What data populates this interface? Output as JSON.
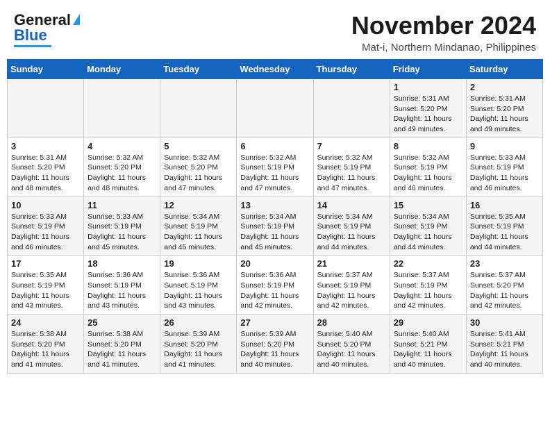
{
  "header": {
    "logo_line1": "General",
    "logo_line2": "Blue",
    "month": "November 2024",
    "location": "Mat-i, Northern Mindanao, Philippines"
  },
  "weekdays": [
    "Sunday",
    "Monday",
    "Tuesday",
    "Wednesday",
    "Thursday",
    "Friday",
    "Saturday"
  ],
  "weeks": [
    [
      {
        "day": "",
        "info": ""
      },
      {
        "day": "",
        "info": ""
      },
      {
        "day": "",
        "info": ""
      },
      {
        "day": "",
        "info": ""
      },
      {
        "day": "",
        "info": ""
      },
      {
        "day": "1",
        "info": "Sunrise: 5:31 AM\nSunset: 5:20 PM\nDaylight: 11 hours\nand 49 minutes."
      },
      {
        "day": "2",
        "info": "Sunrise: 5:31 AM\nSunset: 5:20 PM\nDaylight: 11 hours\nand 49 minutes."
      }
    ],
    [
      {
        "day": "3",
        "info": "Sunrise: 5:31 AM\nSunset: 5:20 PM\nDaylight: 11 hours\nand 48 minutes."
      },
      {
        "day": "4",
        "info": "Sunrise: 5:32 AM\nSunset: 5:20 PM\nDaylight: 11 hours\nand 48 minutes."
      },
      {
        "day": "5",
        "info": "Sunrise: 5:32 AM\nSunset: 5:20 PM\nDaylight: 11 hours\nand 47 minutes."
      },
      {
        "day": "6",
        "info": "Sunrise: 5:32 AM\nSunset: 5:19 PM\nDaylight: 11 hours\nand 47 minutes."
      },
      {
        "day": "7",
        "info": "Sunrise: 5:32 AM\nSunset: 5:19 PM\nDaylight: 11 hours\nand 47 minutes."
      },
      {
        "day": "8",
        "info": "Sunrise: 5:32 AM\nSunset: 5:19 PM\nDaylight: 11 hours\nand 46 minutes."
      },
      {
        "day": "9",
        "info": "Sunrise: 5:33 AM\nSunset: 5:19 PM\nDaylight: 11 hours\nand 46 minutes."
      }
    ],
    [
      {
        "day": "10",
        "info": "Sunrise: 5:33 AM\nSunset: 5:19 PM\nDaylight: 11 hours\nand 46 minutes."
      },
      {
        "day": "11",
        "info": "Sunrise: 5:33 AM\nSunset: 5:19 PM\nDaylight: 11 hours\nand 45 minutes."
      },
      {
        "day": "12",
        "info": "Sunrise: 5:34 AM\nSunset: 5:19 PM\nDaylight: 11 hours\nand 45 minutes."
      },
      {
        "day": "13",
        "info": "Sunrise: 5:34 AM\nSunset: 5:19 PM\nDaylight: 11 hours\nand 45 minutes."
      },
      {
        "day": "14",
        "info": "Sunrise: 5:34 AM\nSunset: 5:19 PM\nDaylight: 11 hours\nand 44 minutes."
      },
      {
        "day": "15",
        "info": "Sunrise: 5:34 AM\nSunset: 5:19 PM\nDaylight: 11 hours\nand 44 minutes."
      },
      {
        "day": "16",
        "info": "Sunrise: 5:35 AM\nSunset: 5:19 PM\nDaylight: 11 hours\nand 44 minutes."
      }
    ],
    [
      {
        "day": "17",
        "info": "Sunrise: 5:35 AM\nSunset: 5:19 PM\nDaylight: 11 hours\nand 43 minutes."
      },
      {
        "day": "18",
        "info": "Sunrise: 5:36 AM\nSunset: 5:19 PM\nDaylight: 11 hours\nand 43 minutes."
      },
      {
        "day": "19",
        "info": "Sunrise: 5:36 AM\nSunset: 5:19 PM\nDaylight: 11 hours\nand 43 minutes."
      },
      {
        "day": "20",
        "info": "Sunrise: 5:36 AM\nSunset: 5:19 PM\nDaylight: 11 hours\nand 42 minutes."
      },
      {
        "day": "21",
        "info": "Sunrise: 5:37 AM\nSunset: 5:19 PM\nDaylight: 11 hours\nand 42 minutes."
      },
      {
        "day": "22",
        "info": "Sunrise: 5:37 AM\nSunset: 5:19 PM\nDaylight: 11 hours\nand 42 minutes."
      },
      {
        "day": "23",
        "info": "Sunrise: 5:37 AM\nSunset: 5:20 PM\nDaylight: 11 hours\nand 42 minutes."
      }
    ],
    [
      {
        "day": "24",
        "info": "Sunrise: 5:38 AM\nSunset: 5:20 PM\nDaylight: 11 hours\nand 41 minutes."
      },
      {
        "day": "25",
        "info": "Sunrise: 5:38 AM\nSunset: 5:20 PM\nDaylight: 11 hours\nand 41 minutes."
      },
      {
        "day": "26",
        "info": "Sunrise: 5:39 AM\nSunset: 5:20 PM\nDaylight: 11 hours\nand 41 minutes."
      },
      {
        "day": "27",
        "info": "Sunrise: 5:39 AM\nSunset: 5:20 PM\nDaylight: 11 hours\nand 40 minutes."
      },
      {
        "day": "28",
        "info": "Sunrise: 5:40 AM\nSunset: 5:20 PM\nDaylight: 11 hours\nand 40 minutes."
      },
      {
        "day": "29",
        "info": "Sunrise: 5:40 AM\nSunset: 5:21 PM\nDaylight: 11 hours\nand 40 minutes."
      },
      {
        "day": "30",
        "info": "Sunrise: 5:41 AM\nSunset: 5:21 PM\nDaylight: 11 hours\nand 40 minutes."
      }
    ]
  ]
}
